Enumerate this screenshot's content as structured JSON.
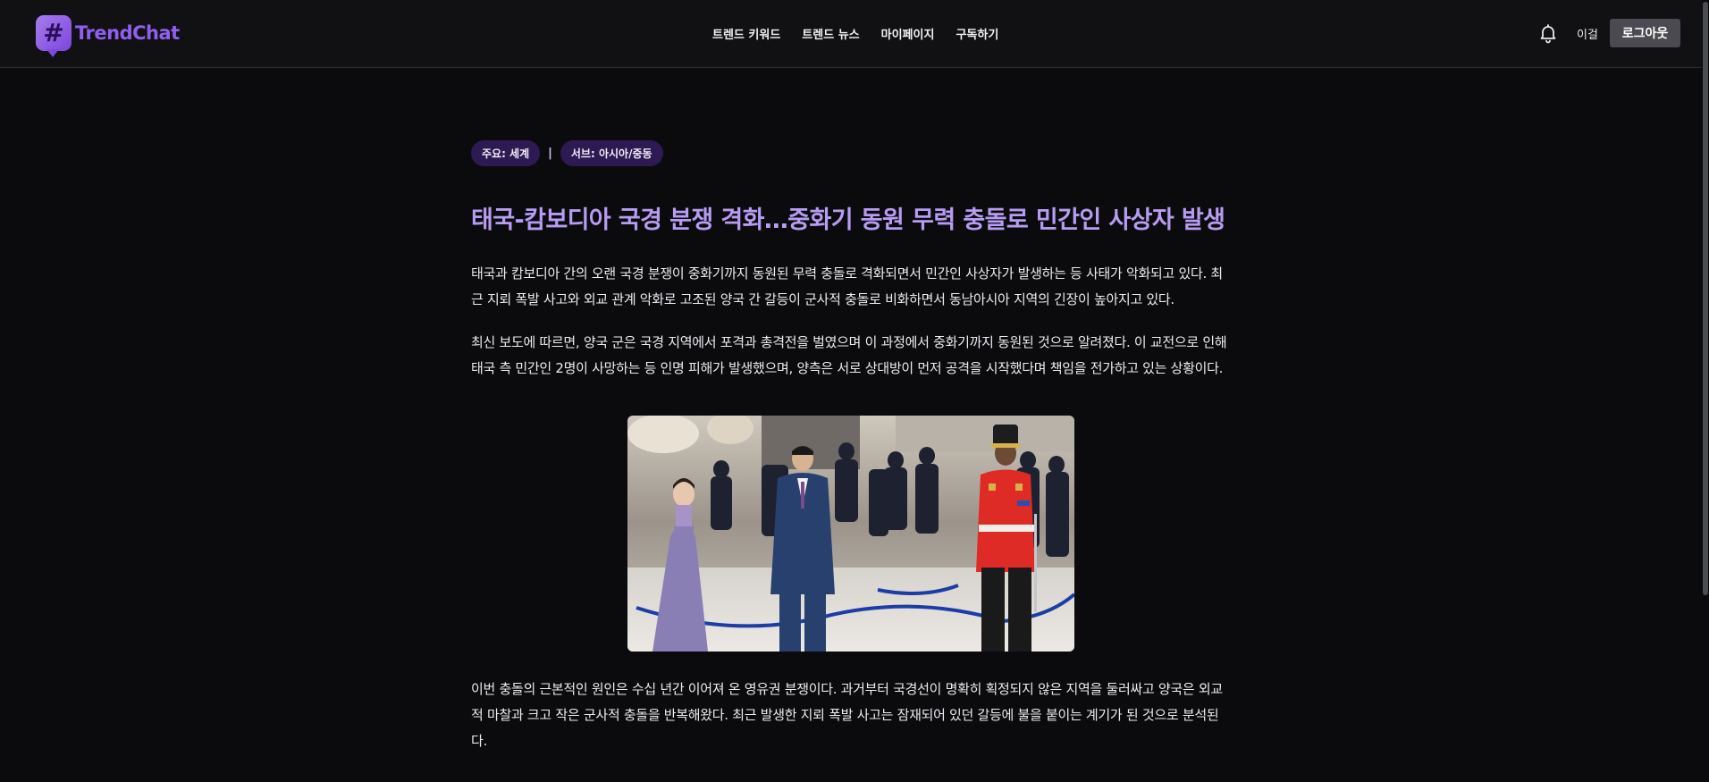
{
  "header": {
    "logo_text": "TrendChat",
    "logo_symbol": "#",
    "nav": [
      "트렌드 키워드",
      "트렌드 뉴스",
      "마이페이지",
      "구독하기"
    ],
    "user_name": "이걸",
    "logout_label": "로그아웃"
  },
  "article": {
    "tags": {
      "main": "주요: 세계",
      "separator": "|",
      "sub": "서브: 아시아/중동"
    },
    "title": "태국-캄보디아 국경 분쟁 격화…중화기 동원 무력 충돌로 민간인 사상자 발생",
    "paragraphs": [
      "태국과 캄보디아 간의 오랜 국경 분쟁이 중화기까지 동원된 무력 충돌로 격화되면서 민간인 사상자가 발생하는 등 사태가 악화되고 있다. 최근 지뢰 폭발 사고와 외교 관계 악화로 고조된 양국 간 갈등이 군사적 충돌로 비화하면서 동남아시아 지역의 긴장이 높아지고 있다.",
      "최신 보도에 따르면, 양국 군은 국경 지역에서 포격과 총격전을 벌였으며 이 과정에서 중화기까지 동원된 것으로 알려졌다. 이 교전으로 인해 태국 측 민간인 2명이 사망하는 등 인명 피해가 발생했으며, 양측은 서로 상대방이 먼저 공격을 시작했다며 책임을 전가하고 있는 상황이다.",
      "이번 충돌의 근본적인 원인은 수십 년간 이어져 온 영유권 분쟁이다. 과거부터 국경선이 명확히 획정되지 않은 지역을 둘러싸고 양국은 외교적 마찰과 크고 작은 군사적 충돌을 반복해왔다. 최근 발생한 지뢰 폭발 사고는 잠재되어 있던 갈등에 불을 붙이는 계기가 된 것으로 분석된다."
    ]
  },
  "colors": {
    "background": "#0b0b0d",
    "header_bg": "#111113",
    "accent_purple": "#8f5ff0",
    "title_color": "#b79cf3",
    "tag_bg": "#2e1a52",
    "logout_bg": "#4a4a50"
  },
  "icons": {
    "logo": "hashtag-chat-bubble-icon",
    "notifications": "bell-icon"
  }
}
